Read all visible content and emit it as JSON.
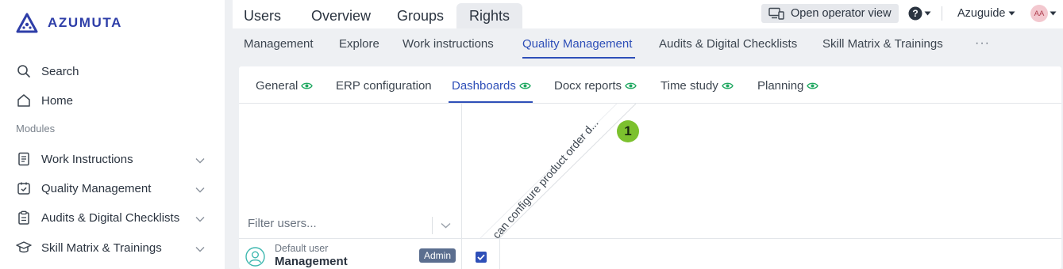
{
  "brand": {
    "name": "AZUMUTA",
    "color": "#2e3ea8"
  },
  "sidebar": {
    "search_label": "Search",
    "home_label": "Home",
    "modules_label": "Modules",
    "items": [
      {
        "label": "Work Instructions",
        "icon": "document-icon"
      },
      {
        "label": "Quality Management",
        "icon": "calendar-check-icon"
      },
      {
        "label": "Audits & Digital Checklists",
        "icon": "clipboard-icon"
      },
      {
        "label": "Skill Matrix & Trainings",
        "icon": "graduation-cap-icon"
      }
    ]
  },
  "topbar": {
    "tabs": [
      "Users",
      "Overview",
      "Groups",
      "Rights"
    ],
    "active_tab": "Rights",
    "operator_view_label": "Open operator view",
    "workspace": "Azuguide",
    "avatar_initials": "AA"
  },
  "subnav": {
    "tabs": [
      "Management",
      "Explore",
      "Work instructions",
      "Quality Management",
      "Audits & Digital Checklists",
      "Skill Matrix & Trainings"
    ],
    "active_tab": "Quality Management",
    "more_label": "···"
  },
  "inner_tabs": {
    "tabs": [
      "General",
      "ERP configuration",
      "Dashboards",
      "Docx reports",
      "Time study",
      "Planning"
    ],
    "active_tab": "Dashboards"
  },
  "matrix": {
    "filter_placeholder": "Filter users...",
    "column_header": "can configure product order d...",
    "step_marker": "1",
    "user": {
      "subtitle": "Default user",
      "name": "Management",
      "role_badge": "Admin",
      "checked": true
    }
  },
  "colors": {
    "accent": "#2e4fb8",
    "eye": "#1fa860",
    "marker": "#7cc12e",
    "badge": "#5b6e8f"
  }
}
